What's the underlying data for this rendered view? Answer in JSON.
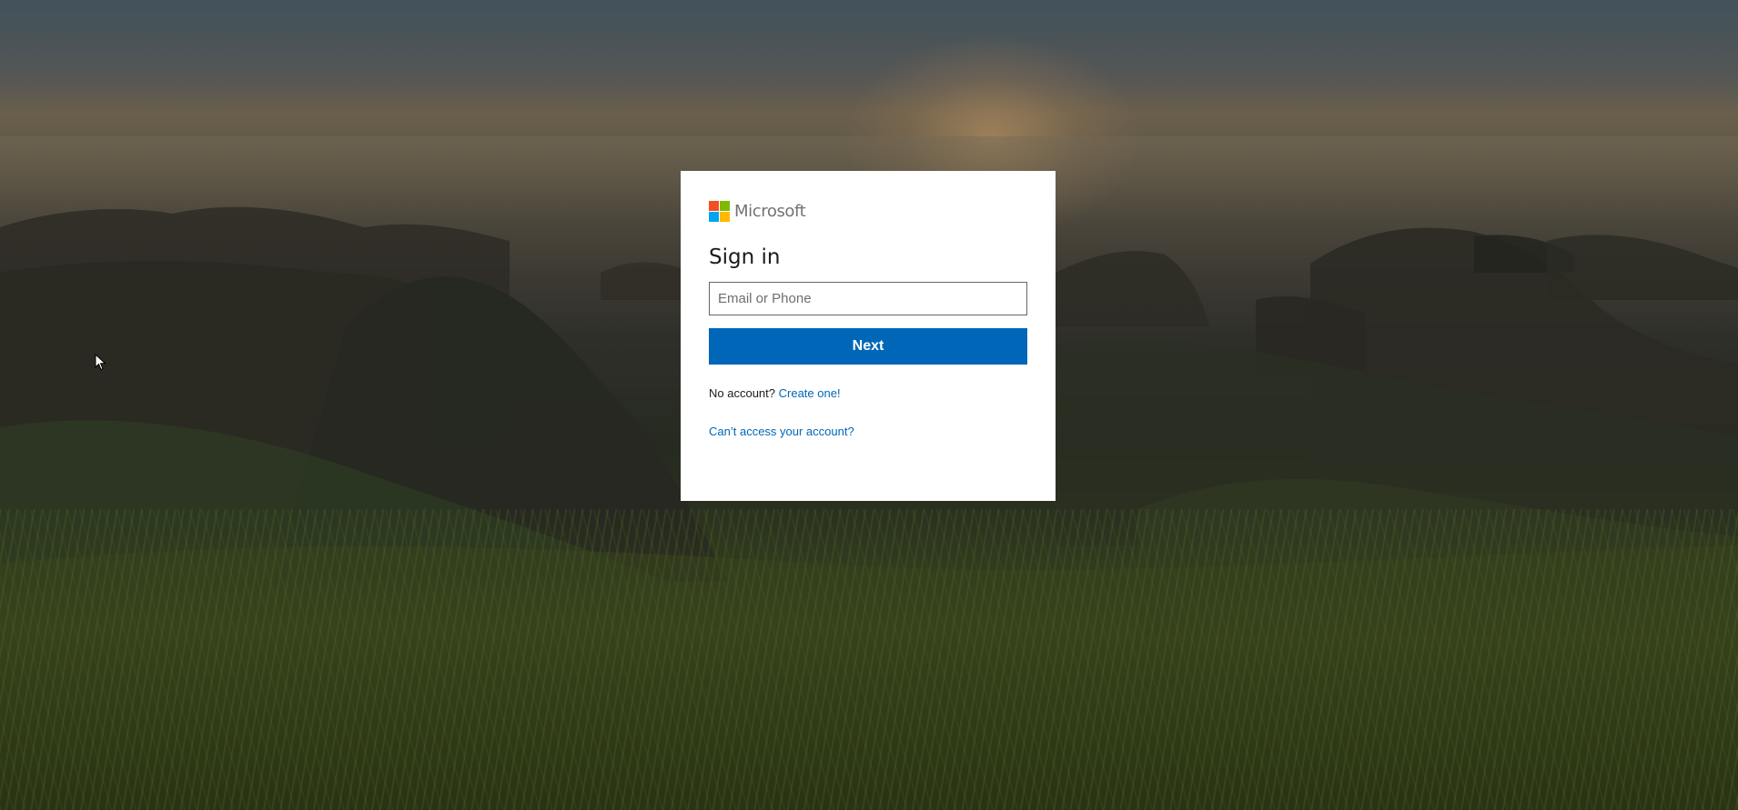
{
  "brand": {
    "name": "Microsoft",
    "logo_colors": [
      "#f25022",
      "#7fba00",
      "#00a4ef",
      "#ffb900"
    ]
  },
  "signin": {
    "title": "Sign in",
    "email_placeholder": "Email or Phone",
    "email_value": "",
    "next_label": "Next",
    "no_account_text": "No account?",
    "create_link": "Create one!",
    "cant_access_link": "Can’t access your account?"
  },
  "colors": {
    "accent": "#0067b8",
    "card_background": "#ffffff"
  },
  "icons": {
    "cursor": "mouse-pointer-icon"
  }
}
